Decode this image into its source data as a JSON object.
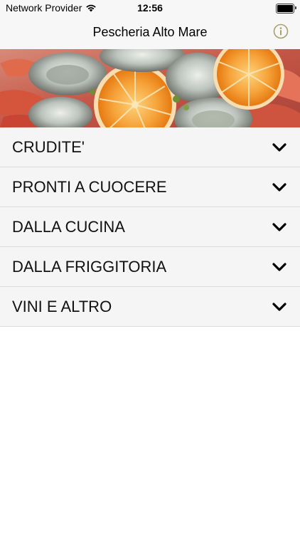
{
  "status_bar": {
    "carrier": "Network Provider",
    "time": "12:56",
    "wifi_icon": "wifi-icon",
    "battery_icon": "battery-icon"
  },
  "nav": {
    "title": "Pescheria Alto Mare",
    "info_icon": "info-icon",
    "accent_color": "#a8a06a"
  },
  "hero": {
    "image": "seafood-platter-oysters-oranges"
  },
  "menu": {
    "items": [
      {
        "label": "CRUDITE'",
        "icon": "chevron-down-icon"
      },
      {
        "label": "PRONTI A CUOCERE",
        "icon": "chevron-down-icon"
      },
      {
        "label": "DALLA CUCINA",
        "icon": "chevron-down-icon"
      },
      {
        "label": "DALLA FRIGGITORIA",
        "icon": "chevron-down-icon"
      },
      {
        "label": "VINI E ALTRO",
        "icon": "chevron-down-icon"
      }
    ]
  }
}
